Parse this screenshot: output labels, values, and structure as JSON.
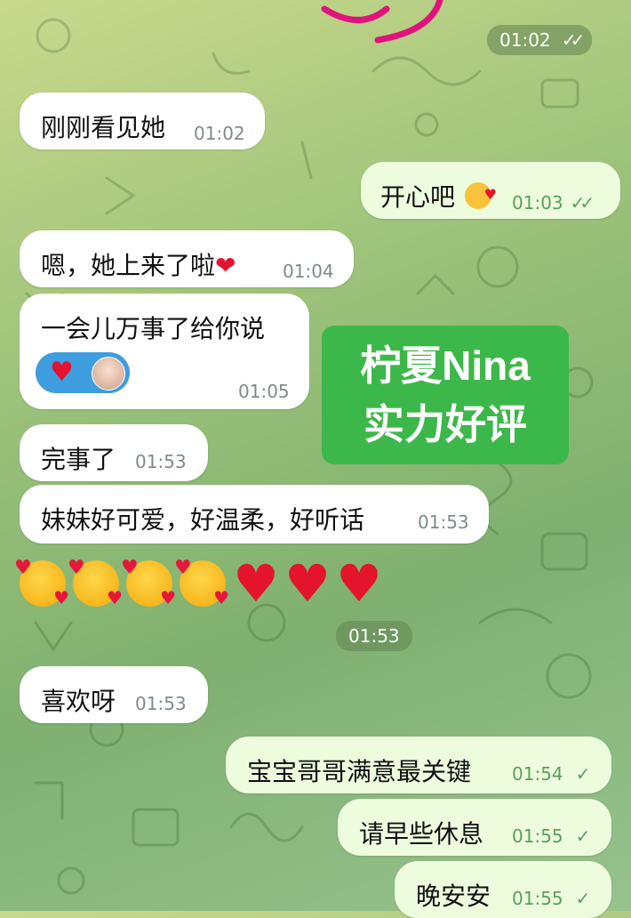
{
  "top_time": {
    "text": "01:02",
    "status": "read"
  },
  "messages": [
    {
      "id": "m1",
      "dir": "in",
      "text": "刚刚看见她",
      "time": "01:02"
    },
    {
      "id": "m2",
      "dir": "out",
      "text": "开心吧",
      "emoji": "kissing-face-icon",
      "time": "01:03",
      "status": "read"
    },
    {
      "id": "m3",
      "dir": "in",
      "text": "嗯，她上来了啦",
      "emoji": "red-heart-icon",
      "time": "01:04"
    },
    {
      "id": "m4",
      "dir": "in",
      "text": "一会儿万事了给你说",
      "time": "01:05",
      "reaction": "red-heart-icon"
    },
    {
      "id": "m5",
      "dir": "in",
      "text": "完事了",
      "time": "01:53"
    },
    {
      "id": "m6",
      "dir": "in",
      "text": "妹妹好可爱，好温柔，好听话",
      "time": "01:53"
    },
    {
      "id": "m7",
      "dir": "in",
      "type": "emoji",
      "time": "01:53"
    },
    {
      "id": "m8",
      "dir": "in",
      "text": "喜欢呀",
      "time": "01:53"
    },
    {
      "id": "m9",
      "dir": "out",
      "text": "宝宝哥哥满意最关键",
      "time": "01:54",
      "status": "sent"
    },
    {
      "id": "m10",
      "dir": "out",
      "text": "请早些休息",
      "time": "01:55",
      "status": "sent"
    },
    {
      "id": "m11",
      "dir": "out",
      "text": "晚安安",
      "time": "01:55",
      "status": "sent"
    }
  ],
  "overlay_badge": {
    "line1": "柠夏Nina",
    "line2": "实力好评",
    "color": "#3cb84a"
  },
  "colors": {
    "incoming": "#ffffff",
    "outgoing": "#eefcde",
    "accent": "#58a15c",
    "heart": "#e3122d"
  }
}
